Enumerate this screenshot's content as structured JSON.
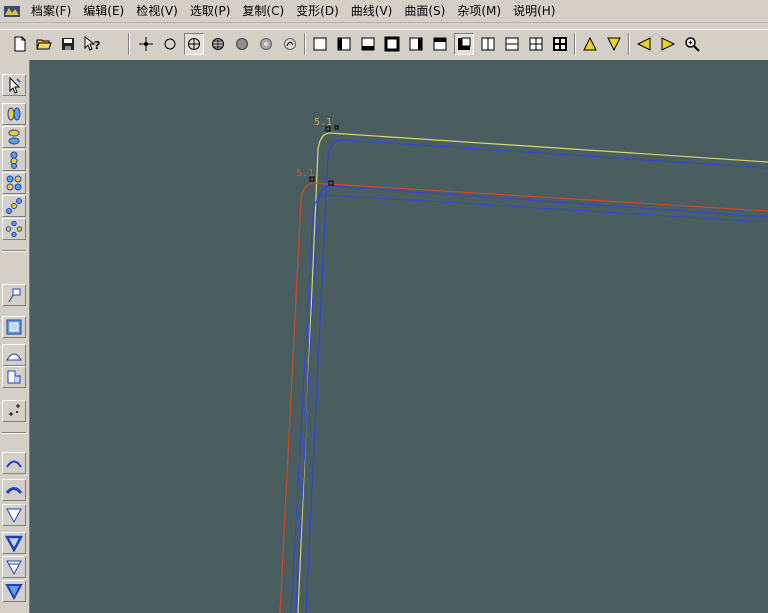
{
  "menu": [
    "档案(F)",
    "编辑(E)",
    "检视(V)",
    "选取(P)",
    "复制(C)",
    "变形(D)",
    "曲线(V)",
    "曲面(S)",
    "杂项(M)",
    "说明(H)"
  ],
  "toolbar": {
    "icons": [
      "new-file-icon",
      "open-folder-icon",
      "save-icon",
      "help-cursor-icon",
      "point-snap-icon",
      "circle-snap-icon",
      "crosshair-circle-icon",
      "grid-circle-icon",
      "filled-circle-icon",
      "dotted-circle-icon",
      "curve-circle-icon",
      "view-full-icon",
      "view-left-icon",
      "view-bottom-icon",
      "view-frame-icon",
      "view-right-icon",
      "view-top-icon",
      "view-corner-icon",
      "view-split-v-icon",
      "view-split-h-icon",
      "view-quad-icon",
      "view-quad-bold-icon",
      "arrow-up-icon",
      "arrow-down-icon",
      "arrow-left-icon",
      "arrow-right-icon",
      "zoom-icon"
    ],
    "pressed": [
      "crosshair-circle-icon",
      "view-corner-icon"
    ]
  },
  "left_toolbar": {
    "icons": [
      "select-pointer-icon",
      "pick-ovals-icon",
      "pick-stack-icon",
      "pick-stack-2-icon",
      "pick-grid-icon",
      "pick-diagonal-icon",
      "pick-ring-icon",
      "flag-icon",
      "box-select-icon",
      "triangle-outline-icon",
      "tab-shape-icon",
      "sparkle-points-icon",
      "arch-up-icon",
      "arch-down-icon",
      "funnel-icon",
      "funnel-bold-icon",
      "funnel-2-icon",
      "funnel-3-icon"
    ]
  },
  "viewport": {
    "background": "#4a5e60",
    "curve_colors": {
      "yellow": "#d8d870",
      "blue": "#2e48d8",
      "red": "#d04828"
    },
    "markers": [
      {
        "name": "upper-curve-label",
        "text": "5.1",
        "color": "#e0a040"
      },
      {
        "name": "lower-curve-label",
        "text": "5.1",
        "color": "#e05028"
      }
    ]
  }
}
